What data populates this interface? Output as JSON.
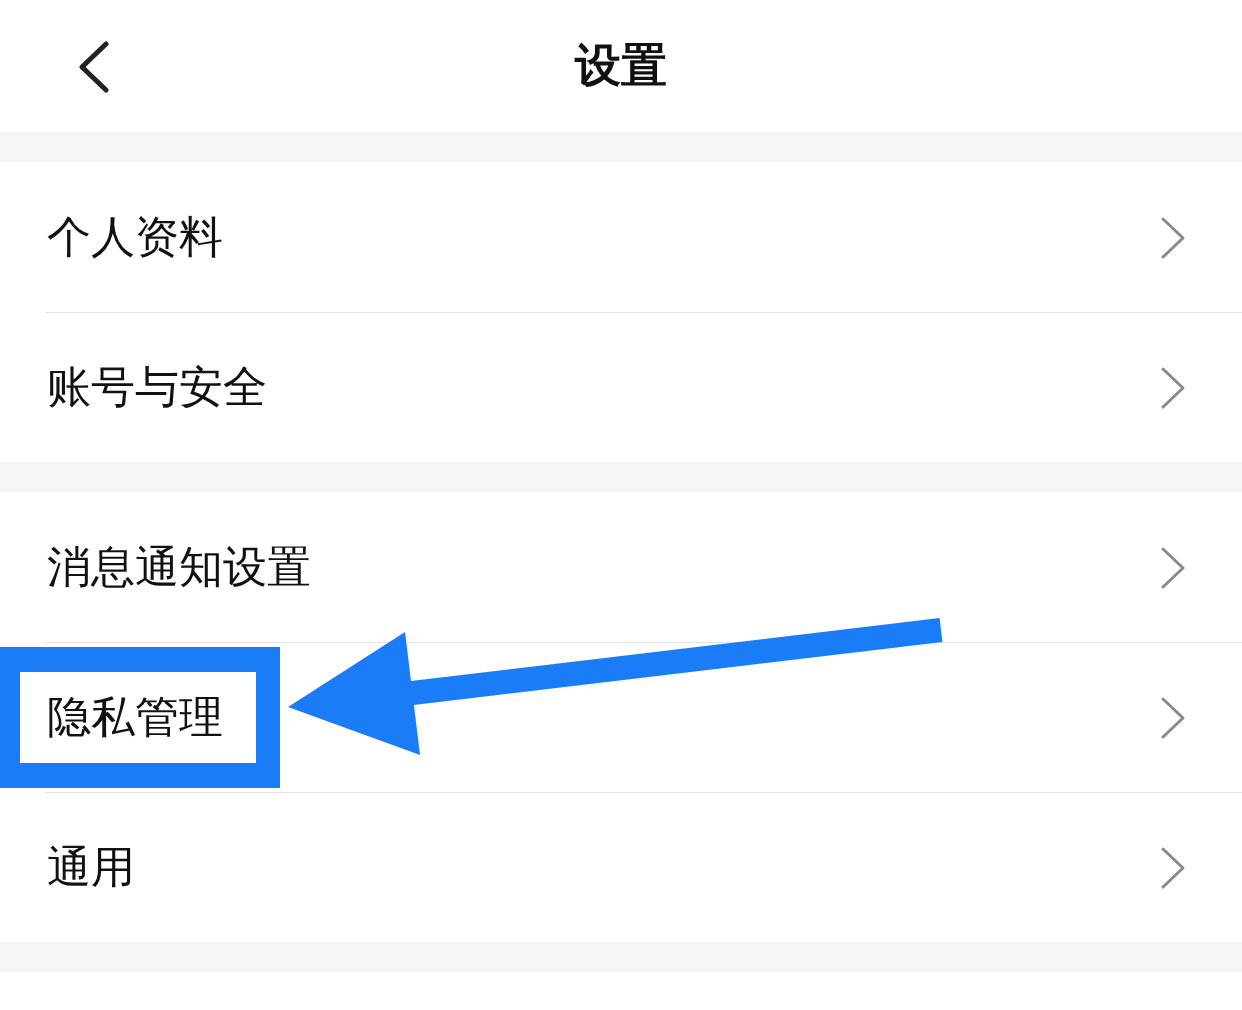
{
  "header": {
    "title": "设置"
  },
  "groups": [
    {
      "items": [
        {
          "label": "个人资料",
          "highlighted": false
        },
        {
          "label": "账号与安全",
          "highlighted": false
        }
      ]
    },
    {
      "items": [
        {
          "label": "消息通知设置",
          "highlighted": false
        },
        {
          "label": "隐私管理",
          "highlighted": true
        },
        {
          "label": "通用",
          "highlighted": false
        }
      ]
    }
  ]
}
